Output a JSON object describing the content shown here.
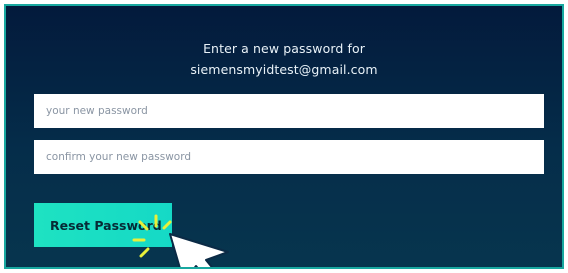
{
  "form": {
    "heading_line1": "Enter a new password for",
    "heading_line2": "siemensmyidtest@gmail.com",
    "new_password_placeholder": "your new password",
    "confirm_password_placeholder": "confirm your new password",
    "reset_button_label": "Reset Password"
  },
  "colors": {
    "frame_border": "#18a8a0",
    "background_top": "#031a3c",
    "background_bottom": "#07354e",
    "button": "#1ee2c2",
    "click_highlight": "#e8f03a",
    "cursor": "#ffffff"
  },
  "icons": {
    "pointer": "cursor-arrow-icon",
    "click": "click-burst-icon"
  }
}
